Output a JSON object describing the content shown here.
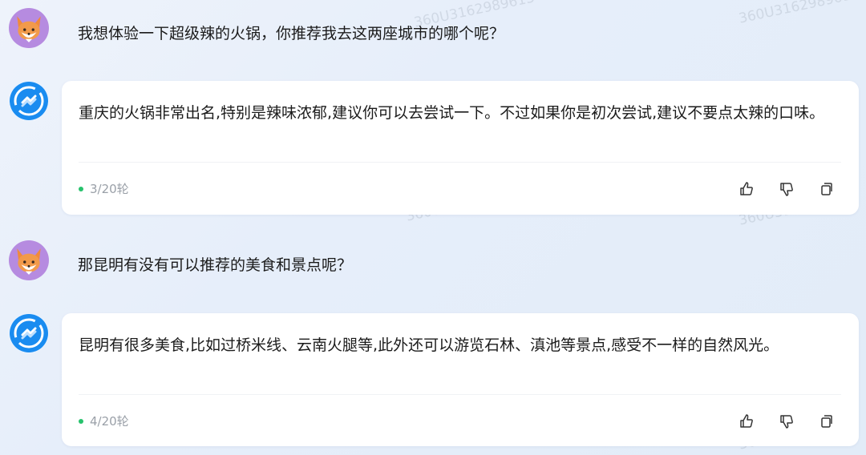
{
  "conversation": [
    {
      "role": "user",
      "text": "我想体验一下超级辣的火锅，你推荐我去这两座城市的哪个呢？"
    },
    {
      "role": "assistant",
      "text": "重庆的火锅非常出名,特别是辣味浓郁,建议你可以去尝试一下。不过如果你是初次尝试,建议不要点太辣的口味。",
      "turn": "3/20轮"
    },
    {
      "role": "user",
      "text": "那昆明有没有可以推荐的美食和景点呢？"
    },
    {
      "role": "assistant",
      "text": "昆明有很多美食,比如过桥米线、云南火腿等,此外还可以游览石林、滇池等景点,感受不一样的自然风光。",
      "turn": "4/20轮"
    }
  ],
  "watermarks": [
    "360U3162989613",
    "3162989613"
  ],
  "icons": {
    "user_avatar": "fox-avatar-icon",
    "bot_avatar": "assistant-logo-icon",
    "like": "thumbs-up-icon",
    "dislike": "thumbs-down-icon",
    "copy": "copy-icon"
  },
  "colors": {
    "accent_green": "#27c26c",
    "bot_blue": "#1a8cf0",
    "user_purple": "#b68be0"
  }
}
